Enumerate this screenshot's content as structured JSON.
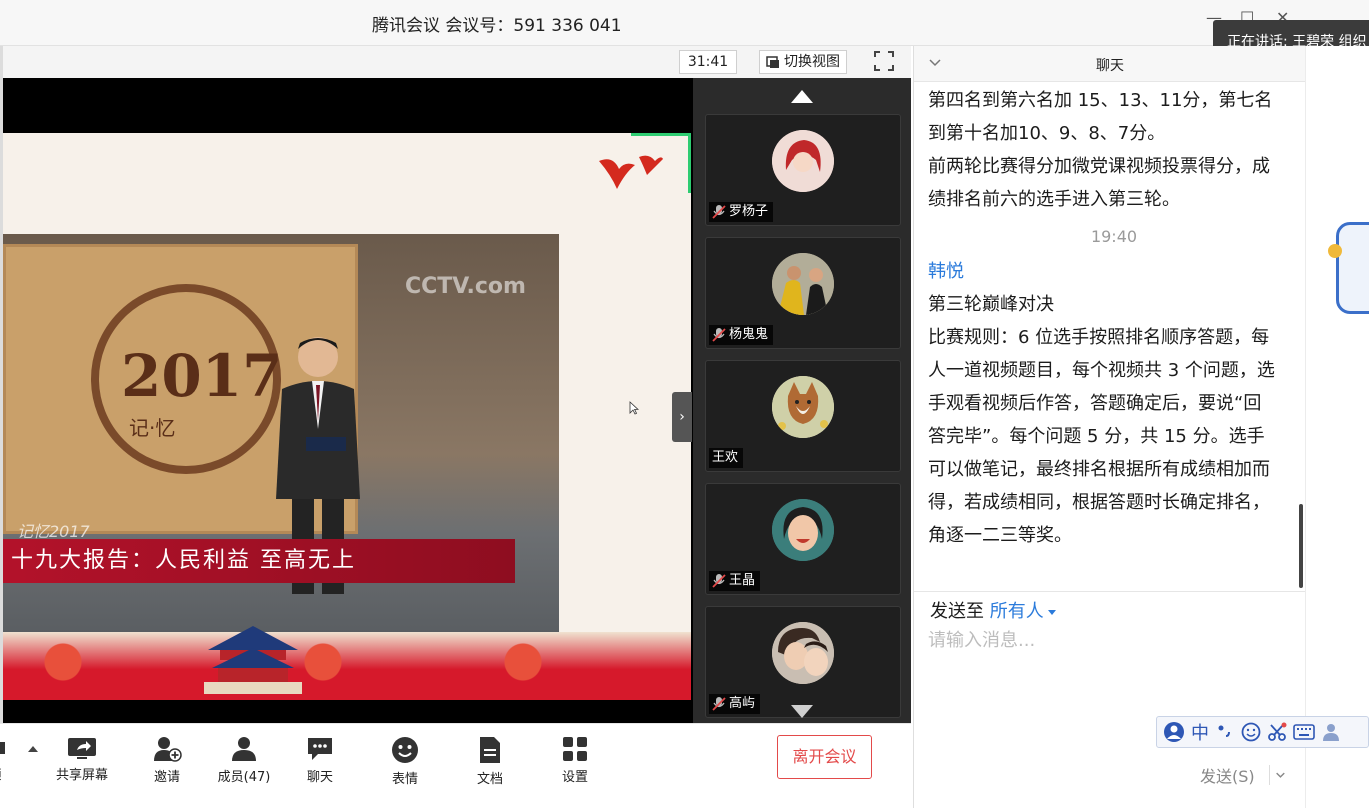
{
  "window": {
    "title": "腾讯会议 会议号：591 336 041"
  },
  "speaking_toast": "正在讲话: 王碧荣 组织",
  "video_toolbar": {
    "timer": "31:41",
    "switch_view_label": "切换视图"
  },
  "shared_content": {
    "emblem_year": "2017",
    "emblem_subtitle": "记·忆",
    "channel_logo": "CCTV.com",
    "banner_small": "记忆2017",
    "banner_main": "十九大报告：人民利益 至高无上"
  },
  "participants": [
    {
      "name": "罗杨子",
      "muted": true
    },
    {
      "name": "杨鬼鬼",
      "muted": true
    },
    {
      "name": "王欢",
      "muted": false
    },
    {
      "name": "王晶",
      "muted": true
    },
    {
      "name": "高屿",
      "muted": true
    }
  ],
  "toolbar": {
    "video_label_partial": "频",
    "share_screen": "共享屏幕",
    "invite": "邀请",
    "members": "成员(47)",
    "chat": "聊天",
    "reactions": "表情",
    "documents": "文档",
    "settings": "设置",
    "leave": "离开会议"
  },
  "chat": {
    "title": "聊天",
    "earlier_lines": [
      "第四名到第六名加 15、13、11分，第七名",
      "到第十名加10、9、8、7分。",
      "前两轮比赛得分加微党课视频投票得分，成",
      "绩排名前六的选手进入第三轮。"
    ],
    "timestamp": "19:40",
    "sender": "韩悦",
    "message_lines": [
      "第三轮巅峰对决",
      "比赛规则：6 位选手按照排名顺序答题，每",
      "人一道视频题目，每个视频共 3 个问题，选",
      "手观看视频后作答，答题确定后，要说“回",
      "答完毕”。每个问题 5 分，共 15 分。选手",
      "可以做笔记，最终排名根据所有成绩相加而",
      "得，若成绩相同，根据答题时长确定排名，",
      "角逐一二三等奖。"
    ],
    "send_to_label": "发送至",
    "send_to_target": "所有人",
    "input_placeholder": "请输入消息...",
    "send_button": "发送(S)"
  },
  "ime_toolbar": {
    "mode": "中"
  },
  "colors": {
    "accent_blue": "#2b7bdb",
    "leave_red": "#e34a4a",
    "banner_red": "#b3122a",
    "participants_bg": "#2b2b2b"
  }
}
